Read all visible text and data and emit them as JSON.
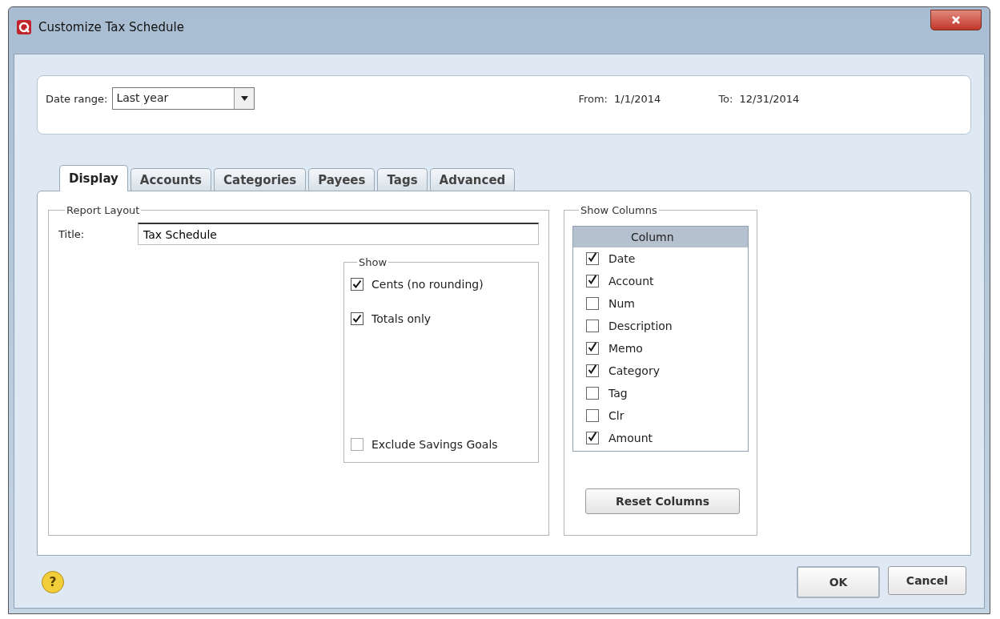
{
  "window": {
    "title": "Customize Tax Schedule"
  },
  "date_range": {
    "label": "Date range:",
    "value": "Last year",
    "from_label": "From:",
    "from": "1/1/2014",
    "to_label": "To:",
    "to": "12/31/2014"
  },
  "tabs": [
    {
      "label": "Display",
      "selected": true
    },
    {
      "label": "Accounts",
      "selected": false
    },
    {
      "label": "Categories",
      "selected": false
    },
    {
      "label": "Payees",
      "selected": false
    },
    {
      "label": "Tags",
      "selected": false
    },
    {
      "label": "Advanced",
      "selected": false
    }
  ],
  "report_layout": {
    "legend": "Report Layout",
    "title_label": "Title:",
    "title_value": "Tax Schedule",
    "show": {
      "legend": "Show",
      "options": [
        {
          "label": "Cents (no rounding)",
          "checked": true,
          "kind": "top"
        },
        {
          "label": "Totals only",
          "checked": true,
          "kind": "top"
        },
        {
          "label": "Exclude Savings Goals",
          "checked": false,
          "kind": "bottom"
        }
      ]
    }
  },
  "show_columns": {
    "legend": "Show Columns",
    "header": "Column",
    "items": [
      {
        "label": "Date",
        "checked": true
      },
      {
        "label": "Account",
        "checked": true
      },
      {
        "label": "Num",
        "checked": false
      },
      {
        "label": "Description",
        "checked": false
      },
      {
        "label": "Memo",
        "checked": true
      },
      {
        "label": "Category",
        "checked": true
      },
      {
        "label": "Tag",
        "checked": false
      },
      {
        "label": "Clr",
        "checked": false
      },
      {
        "label": "Amount",
        "checked": true
      }
    ],
    "reset_button": "Reset Columns"
  },
  "help": "?",
  "buttons": [
    {
      "label": "OK",
      "kind": "default"
    },
    {
      "label": "Cancel",
      "kind": "normal"
    }
  ]
}
